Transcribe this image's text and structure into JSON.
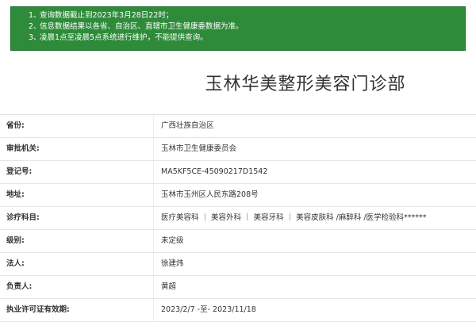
{
  "notice": {
    "lines": [
      {
        "num": "1、",
        "text": "查询数据截止到2023年3月28日22时；"
      },
      {
        "num": "2、",
        "text": "信息数据结果以各省、自治区、直辖市卫生健康委数据为准。"
      },
      {
        "num": "3、",
        "text": "凌晨1点至凌晨5点系统进行维护，不能提供查询。"
      }
    ]
  },
  "page_title": "玉林华美整形美容门诊部",
  "rows": [
    {
      "label": "省份:",
      "value": "广西壮族自治区"
    },
    {
      "label": "审批机关:",
      "value": "玉林市卫生健康委员会"
    },
    {
      "label": "登记号:",
      "value": "MA5KF5CE-45090217D1542"
    },
    {
      "label": "地址:",
      "value": "玉林市玉州区人民东路208号"
    },
    {
      "label": "诊疗科目:",
      "value": "医疗美容科 ｜ 美容外科 ｜ 美容牙科 ｜ 美容皮肤科 /麻醉科 /医学检验科******"
    },
    {
      "label": "级别:",
      "value": "未定级"
    },
    {
      "label": "法人:",
      "value": "徐建炜"
    },
    {
      "label": "负责人:",
      "value": "黄超"
    },
    {
      "label": "执业许可证有效期:",
      "value": "2023/2/7 -至- 2023/11/18"
    }
  ],
  "colors": {
    "notice_bg": "#2e8b3a",
    "text": "#333333"
  }
}
